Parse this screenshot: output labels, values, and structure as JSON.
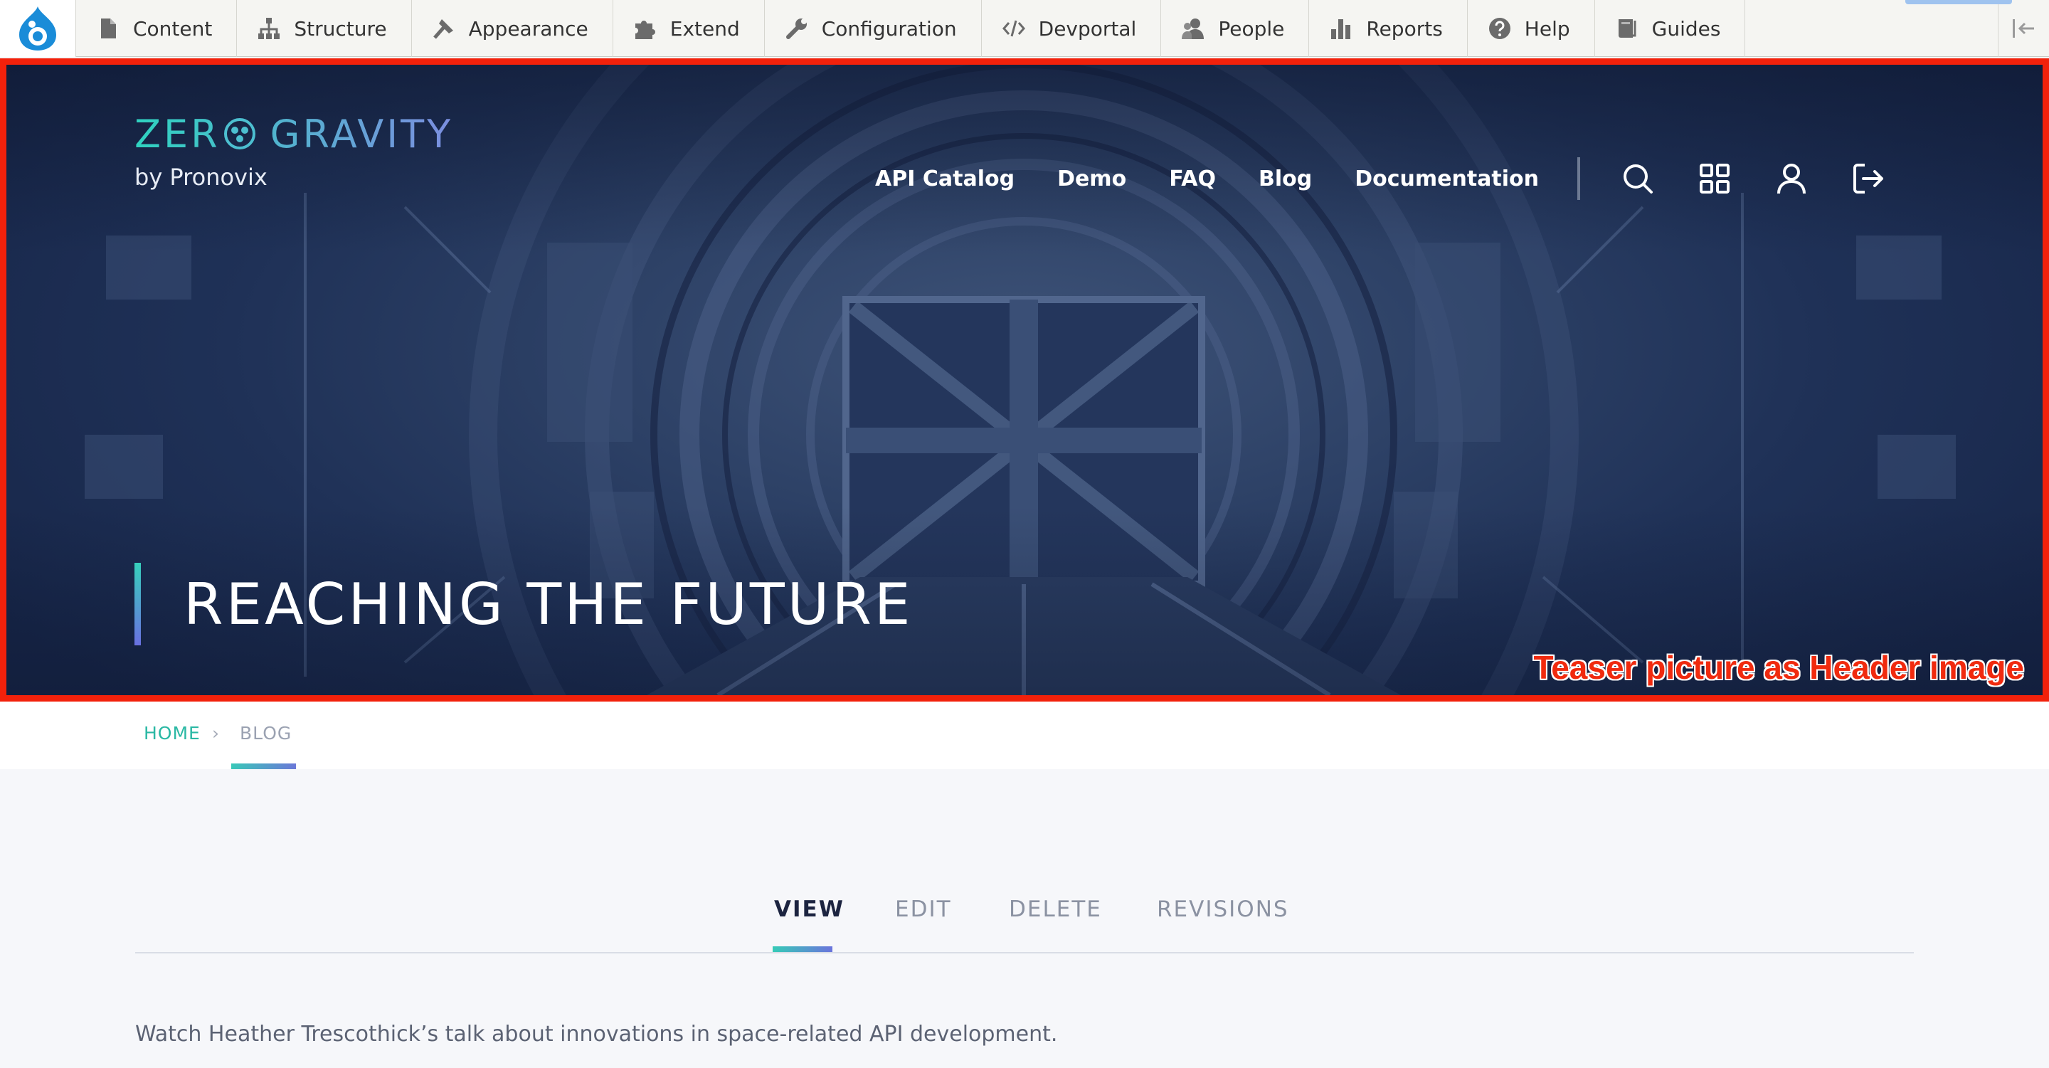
{
  "toolbar": {
    "items": [
      {
        "label": "Content",
        "icon": "content-icon"
      },
      {
        "label": "Structure",
        "icon": "structure-icon"
      },
      {
        "label": "Appearance",
        "icon": "appearance-icon"
      },
      {
        "label": "Extend",
        "icon": "extend-icon"
      },
      {
        "label": "Configuration",
        "icon": "configuration-icon"
      },
      {
        "label": "Devportal",
        "icon": "code-icon"
      },
      {
        "label": "People",
        "icon": "people-icon"
      },
      {
        "label": "Reports",
        "icon": "reports-icon"
      },
      {
        "label": "Help",
        "icon": "help-icon"
      },
      {
        "label": "Guides",
        "icon": "book-icon"
      }
    ]
  },
  "logo": {
    "word1": "ZER",
    "word2": "GRAVITY",
    "sub": "by Pronovix"
  },
  "nav": {
    "links": [
      "API Catalog",
      "Demo",
      "FAQ",
      "Blog",
      "Documentation"
    ],
    "icons": [
      "search-icon",
      "apps-grid-icon",
      "user-icon",
      "logout-icon"
    ]
  },
  "hero": {
    "title": "REACHING THE FUTURE",
    "annotation": "Teaser picture as Header image"
  },
  "breadcrumb": {
    "home": "HOME",
    "separator": "›",
    "current": "BLOG"
  },
  "tabs": {
    "view": "VIEW",
    "edit": "EDIT",
    "delete": "DELETE",
    "revisions": "REVISIONS"
  },
  "content": {
    "text": "Watch Heather Trescothick’s talk about innovations in space-related API development."
  },
  "colors": {
    "accent": "#39c6c3",
    "annotation": "#f02a0e",
    "hero_bg": "#23365c"
  }
}
